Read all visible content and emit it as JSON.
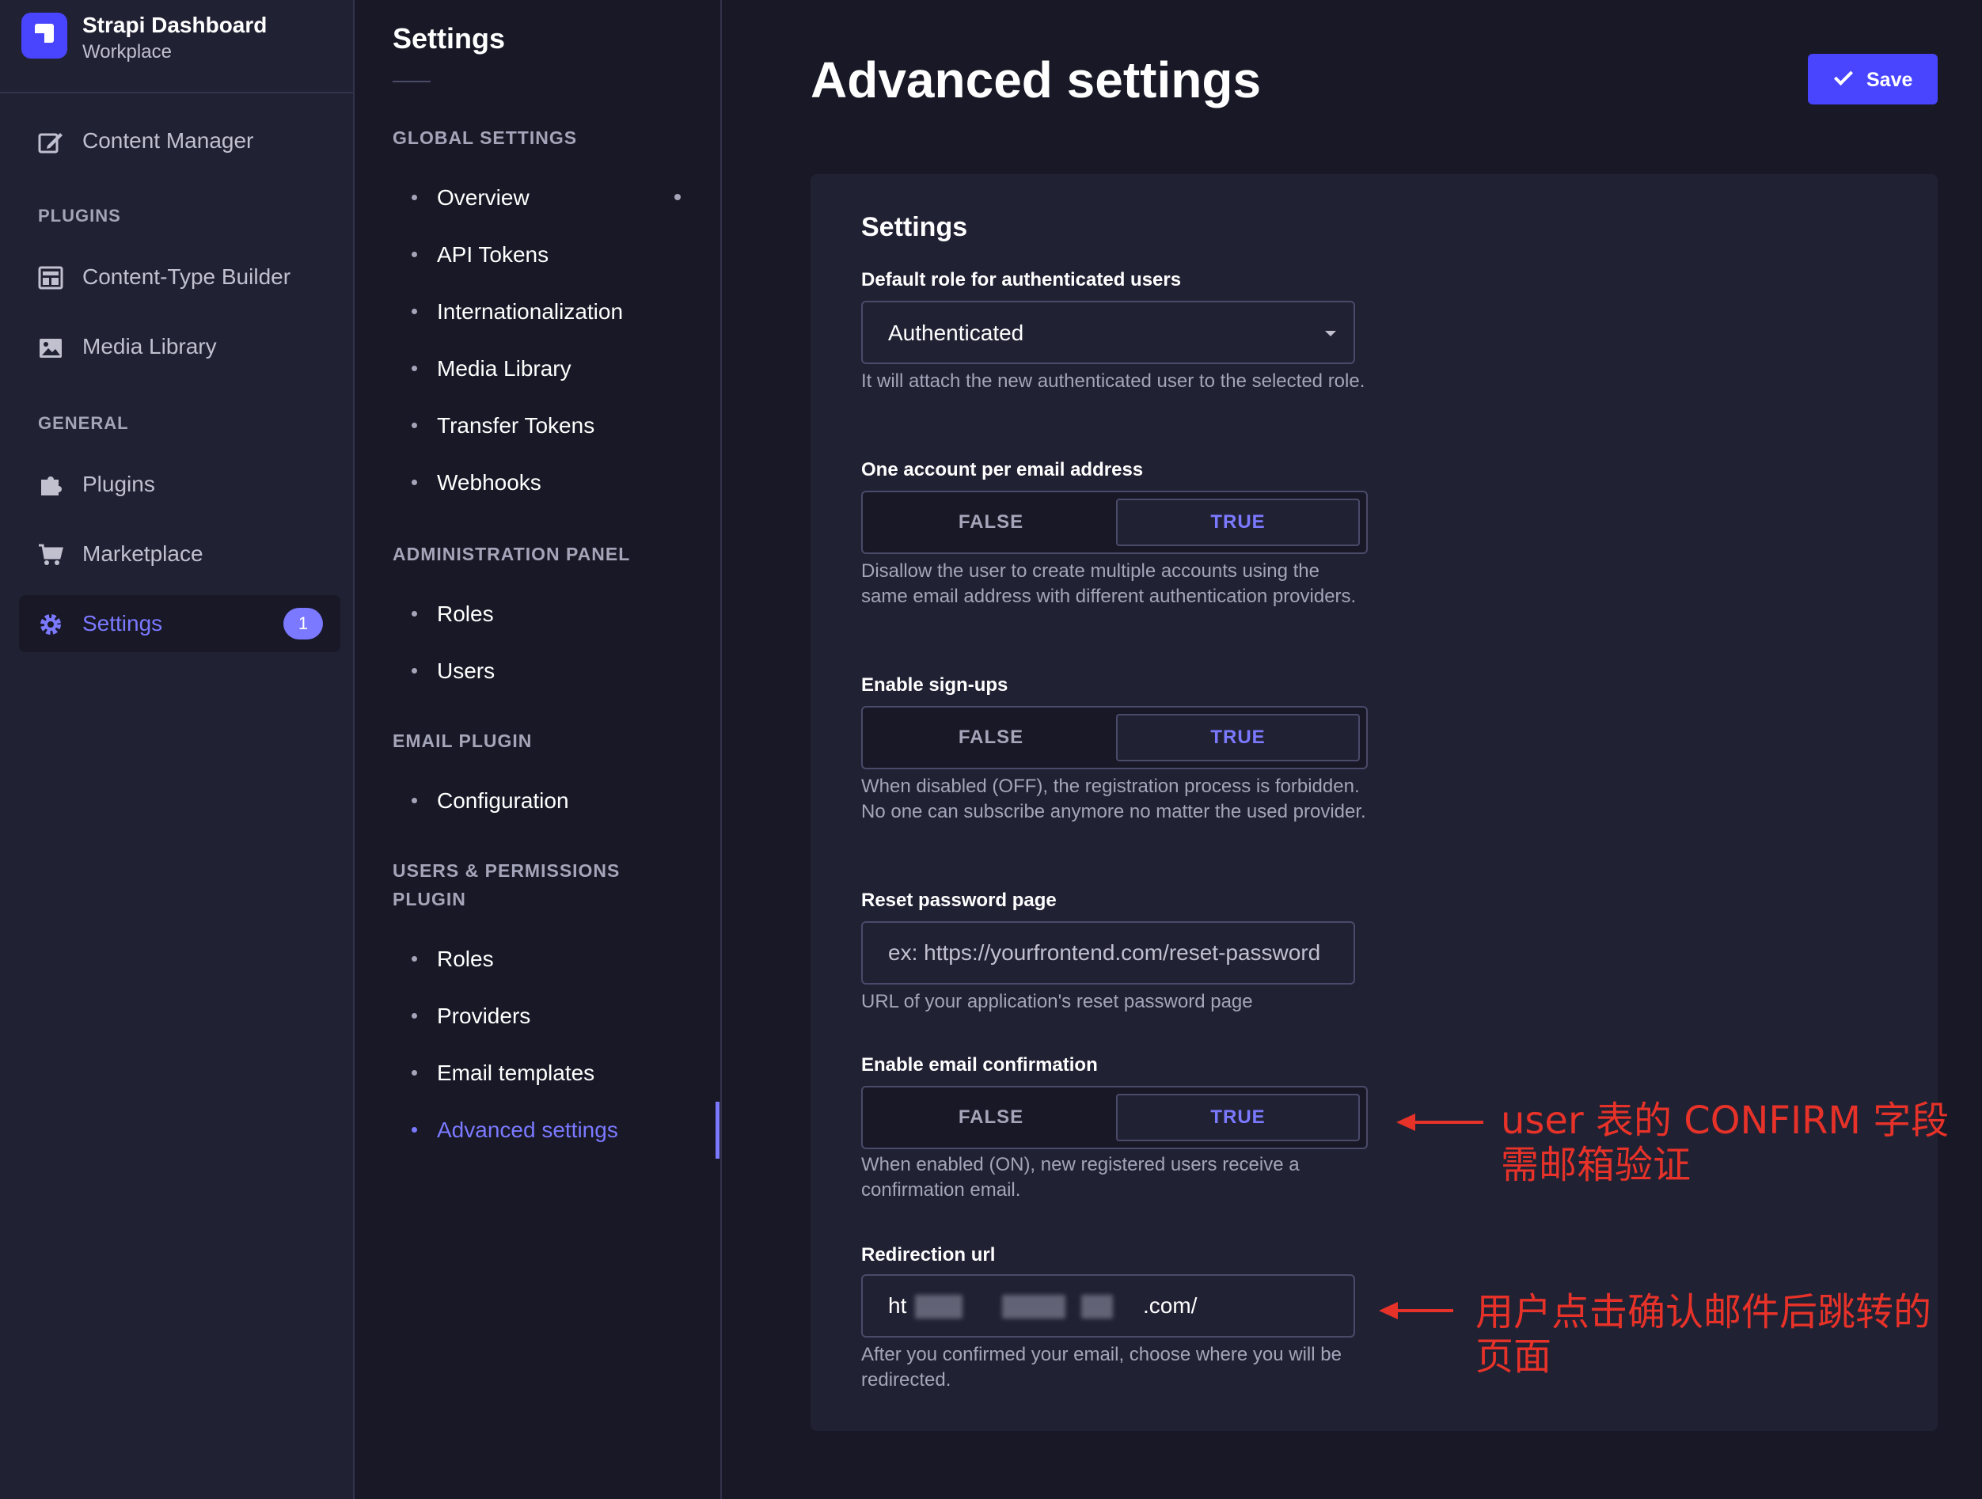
{
  "brand": {
    "title": "Strapi Dashboard",
    "subtitle": "Workplace"
  },
  "main_nav": {
    "content_manager": "Content Manager",
    "plugins_section": "PLUGINS",
    "content_type_builder": "Content-Type Builder",
    "media_library": "Media Library",
    "general_section": "GENERAL",
    "plugins": "Plugins",
    "marketplace": "Marketplace",
    "settings": "Settings",
    "settings_badge": "1"
  },
  "sub_nav": {
    "title": "Settings",
    "global_section": "GLOBAL SETTINGS",
    "global_links": [
      "Overview",
      "API Tokens",
      "Internationalization",
      "Media Library",
      "Transfer Tokens",
      "Webhooks"
    ],
    "admin_section": "ADMINISTRATION PANEL",
    "admin_links": [
      "Roles",
      "Users"
    ],
    "email_section": "EMAIL PLUGIN",
    "email_links": [
      "Configuration"
    ],
    "users_section": "USERS & PERMISSIONS PLUGIN",
    "users_links": [
      "Roles",
      "Providers",
      "Email templates",
      "Advanced settings"
    ]
  },
  "header": {
    "title": "Advanced settings",
    "save_label": "Save"
  },
  "form": {
    "card_title": "Settings",
    "default_role": {
      "label": "Default role for authenticated users",
      "value": "Authenticated",
      "hint": "It will attach the new authenticated user to the selected role."
    },
    "unique_email": {
      "label": "One account per email address",
      "false_label": "FALSE",
      "true_label": "TRUE",
      "selected": "TRUE",
      "hint": "Disallow the user to create multiple accounts using the same email address with different authentication providers."
    },
    "allow_register": {
      "label": "Enable sign-ups",
      "false_label": "FALSE",
      "true_label": "TRUE",
      "selected": "TRUE",
      "hint": "When disabled (OFF), the registration process is forbidden. No one can subscribe anymore no matter the used provider."
    },
    "reset_password": {
      "label": "Reset password page",
      "placeholder": "ex: https://yourfrontend.com/reset-password",
      "hint": "URL of your application's reset password page"
    },
    "email_confirmation": {
      "label": "Enable email confirmation",
      "false_label": "FALSE",
      "true_label": "TRUE",
      "selected": "TRUE",
      "hint": "When enabled (ON), new registered users receive a confirmation email."
    },
    "redirection_url": {
      "label": "Redirection url",
      "value_visible_prefix": "ht",
      "value_visible_suffix": ".com/",
      "hint": "After you confirmed your email, choose where you will be redirected."
    }
  },
  "annotations": {
    "confirm_note": "user 表的 CONFIRM 字段需邮箱验证",
    "redirect_note": "用户点击确认邮件后跳转的页面"
  },
  "colors": {
    "background": "#181826",
    "nav_background": "#212134",
    "accent": "#7b79ff",
    "primary_button": "#4945ff",
    "annotation": "#e63228"
  }
}
